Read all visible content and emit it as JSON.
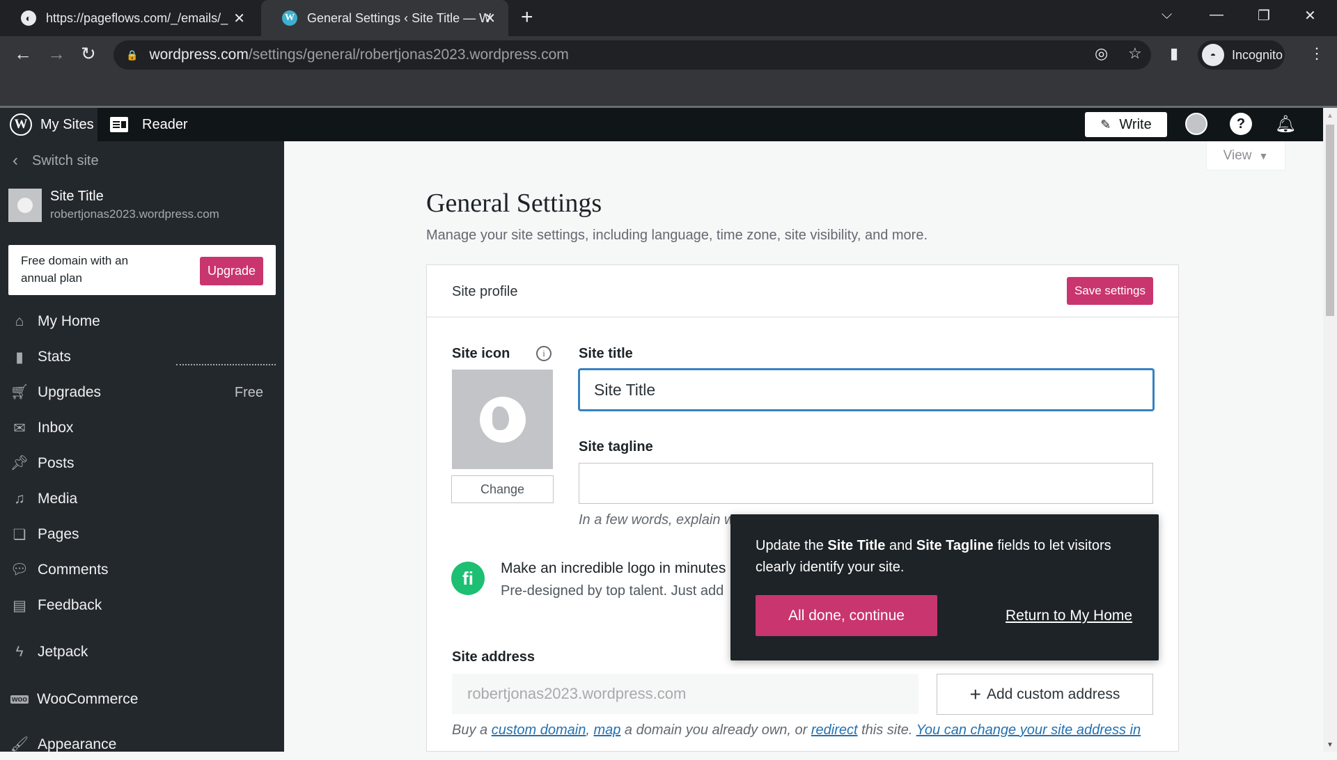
{
  "browser": {
    "tabs": [
      {
        "title": "https://pageflows.com/_/emails/_",
        "favicon": "globe-icon",
        "active": false
      },
      {
        "title": "General Settings ‹ Site Title — WordPress.com",
        "favicon": "wordpress-icon",
        "active": true
      }
    ],
    "new_tab": "+",
    "close_glyph": "✕",
    "url_host": "wordpress.com",
    "url_path": "/settings/general/robertjonas2023.wordpress.com",
    "profile_label": "Incognito",
    "window_controls": {
      "dropdown": "⌵",
      "minimize": "—",
      "restore": "❐",
      "close": "✕"
    }
  },
  "masterbar": {
    "my_sites": "My Sites",
    "reader": "Reader",
    "write": "Write"
  },
  "sidebar": {
    "switch_site": "Switch site",
    "site_name": "Site Title",
    "site_url": "robertjonas2023.wordpress.com",
    "promo_text": "Free domain with an annual plan",
    "upgrade_label": "Upgrade",
    "items": [
      {
        "label": "My Home",
        "icon": "home-icon"
      },
      {
        "label": "Stats",
        "icon": "stats-icon"
      },
      {
        "label": "Upgrades",
        "icon": "cart-icon",
        "badge": "Free"
      },
      {
        "label": "Inbox",
        "icon": "mail-icon"
      },
      {
        "label": "Posts",
        "icon": "pin-icon"
      },
      {
        "label": "Media",
        "icon": "media-icon"
      },
      {
        "label": "Pages",
        "icon": "pages-icon"
      },
      {
        "label": "Comments",
        "icon": "comment-icon"
      },
      {
        "label": "Feedback",
        "icon": "feedback-icon"
      },
      {
        "label": "Jetpack",
        "icon": "jetpack-icon"
      },
      {
        "label": "WooCommerce",
        "icon": "woo-icon"
      },
      {
        "label": "Appearance",
        "icon": "brush-icon"
      }
    ]
  },
  "main": {
    "view_label": "View",
    "title": "General Settings",
    "subtitle": "Manage your site settings, including language, time zone, site visibility, and more.",
    "card_title": "Site profile",
    "save_label": "Save settings",
    "site_icon_label": "Site icon",
    "change_label": "Change",
    "site_title_label": "Site title",
    "site_title_value": "Site Title",
    "site_tagline_label": "Site tagline",
    "site_tagline_value": "",
    "tagline_hint": "In a few words, explain w",
    "logo_promo_title": "Make an incredible logo in minutes",
    "logo_promo_sub": "Pre-designed by top talent. Just add",
    "site_address_label": "Site address",
    "site_address_value": "robertjonas2023.wordpress.com",
    "add_custom_address": "Add custom address",
    "address_hint": {
      "t1": "Buy a ",
      "l1": "custom domain",
      "t2": ", ",
      "l2": "map",
      "t3": " a domain you already own, or ",
      "l3": "redirect",
      "t4": " this site. ",
      "l4": "You can change your site address in"
    }
  },
  "tour": {
    "t1": "Update the ",
    "b1": "Site Title",
    "t2": " and ",
    "b2": "Site Tagline",
    "t3": " fields to let visitors clearly identify your site.",
    "primary": "All done, continue",
    "secondary": "Return to My Home"
  },
  "colors": {
    "accent": "#c9356e",
    "focus": "#3582c4",
    "sidebar_bg": "#23282d",
    "masterbar_bg": "#101517"
  }
}
